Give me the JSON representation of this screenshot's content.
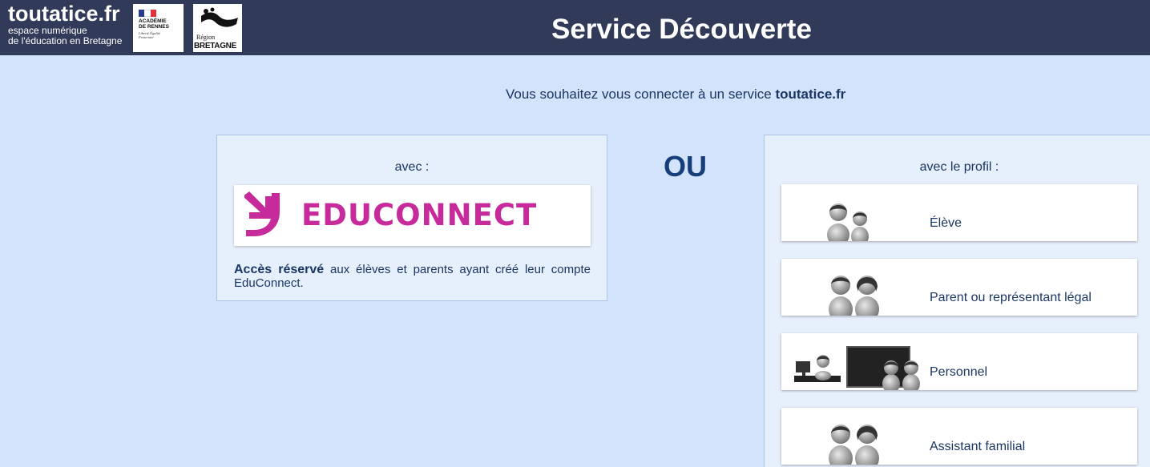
{
  "header": {
    "brand_title": "toutatice.fr",
    "brand_sub_1": "espace numérique",
    "brand_sub_2": "de l'éducation en Bretagne",
    "academie_line1": "ACADÉMIE",
    "academie_line2": "DE RENNES",
    "academie_motto": "Liberté Égalité Fraternité",
    "region_line1": "Région",
    "region_line2": "BRETAGNE",
    "title": "Service Découverte"
  },
  "intro": {
    "text": "Vous souhaitez vous connecter à un service ",
    "brand": "toutatice.fr"
  },
  "left_panel": {
    "avec": "avec :",
    "educonnect_label": "EDUCONNECT",
    "acces_bold": "Accès réservé",
    "acces_text": " aux élèves et parents ayant créé leur compte EduConnect."
  },
  "ou": "OU",
  "right_panel": {
    "avec_profil": "avec le profil :",
    "profiles": [
      {
        "label": "Élève",
        "icon": "student-icon"
      },
      {
        "label": "Parent ou représentant légal",
        "icon": "parents-icon"
      },
      {
        "label": "Personnel",
        "icon": "staff-icon"
      },
      {
        "label": "Assistant familial",
        "icon": "assistant-icon"
      }
    ]
  },
  "colors": {
    "header_bg": "#313b59",
    "page_bg": "#d3e3fb",
    "panel_bg": "#e6effc",
    "text": "#1a3663",
    "educonnect": "#c72b9b"
  }
}
